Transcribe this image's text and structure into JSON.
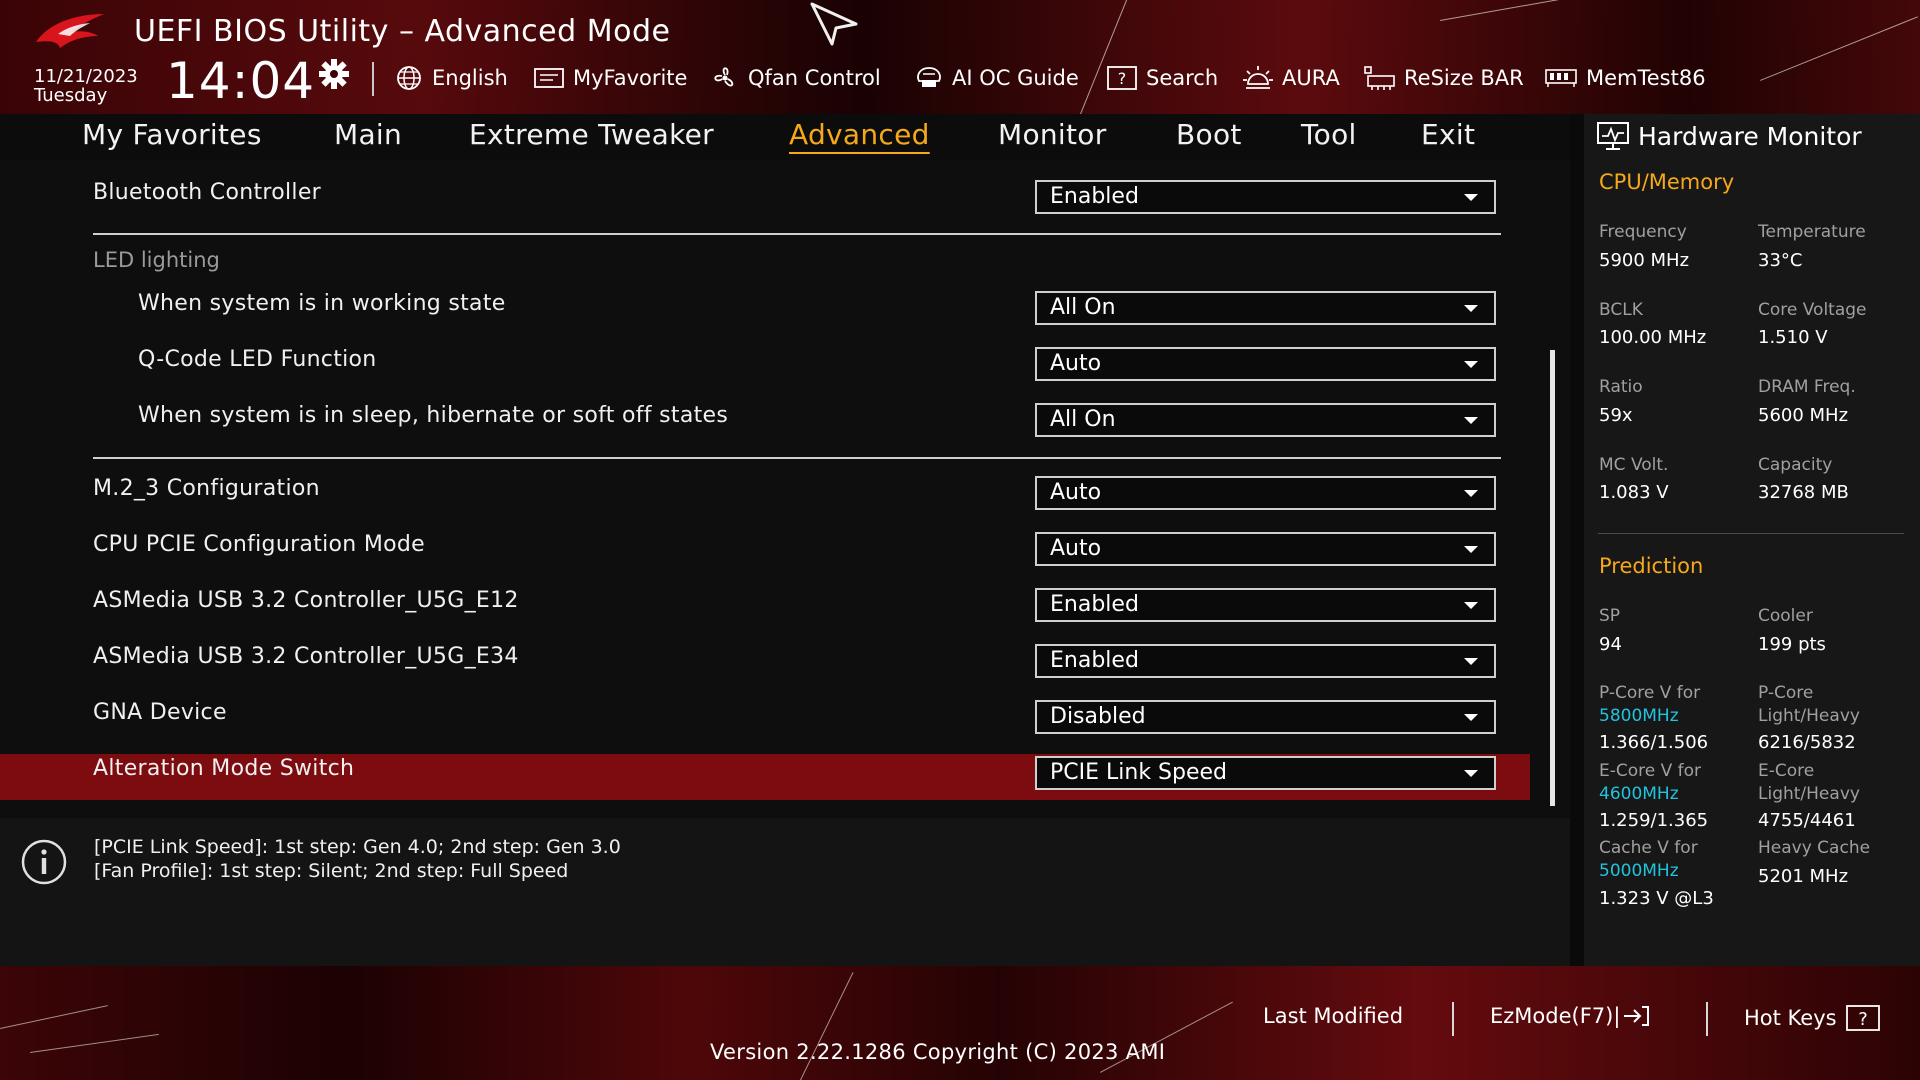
{
  "header": {
    "title": "UEFI BIOS Utility – Advanced Mode",
    "date": "11/21/2023",
    "weekday": "Tuesday",
    "time": "14:04",
    "logo_icon": "rog-eye-logo",
    "toolbar": [
      {
        "label": "English",
        "icon": "globe-icon"
      },
      {
        "label": "MyFavorite",
        "icon": "favorite-card-icon"
      },
      {
        "label": "Qfan Control",
        "icon": "fan-icon"
      },
      {
        "label": "AI OC Guide",
        "icon": "ai-chip-icon"
      },
      {
        "label": "Search",
        "icon": "question-box-icon"
      },
      {
        "label": "AURA",
        "icon": "aura-light-icon"
      },
      {
        "label": "ReSize BAR",
        "icon": "resize-bar-icon"
      },
      {
        "label": "MemTest86",
        "icon": "memory-icon"
      }
    ]
  },
  "tabs": [
    {
      "label": "My Favorites",
      "active": false
    },
    {
      "label": "Main",
      "active": false
    },
    {
      "label": "Extreme Tweaker",
      "active": false
    },
    {
      "label": "Advanced",
      "active": true
    },
    {
      "label": "Monitor",
      "active": false
    },
    {
      "label": "Boot",
      "active": false
    },
    {
      "label": "Tool",
      "active": false
    },
    {
      "label": "Exit",
      "active": false
    }
  ],
  "settings": {
    "bluetooth": {
      "label": "Bluetooth Controller",
      "value": "Enabled"
    },
    "led_group": "LED lighting",
    "led_working": {
      "label": "When system is in working state",
      "value": "All On"
    },
    "qcode": {
      "label": "Q-Code LED Function",
      "value": "Auto"
    },
    "led_sleep": {
      "label": "When system is in sleep, hibernate or soft off states",
      "value": "All On"
    },
    "m2_3": {
      "label": "M.2_3 Configuration",
      "value": "Auto"
    },
    "cpu_pcie": {
      "label": "CPU PCIE Configuration Mode",
      "value": "Auto"
    },
    "asmedia_e12": {
      "label": "ASMedia USB 3.2 Controller_U5G_E12",
      "value": "Enabled"
    },
    "asmedia_e34": {
      "label": "ASMedia USB 3.2 Controller_U5G_E34",
      "value": "Enabled"
    },
    "gna": {
      "label": "GNA Device",
      "value": "Disabled"
    },
    "alteration": {
      "label": "Alteration Mode Switch",
      "value": "PCIE Link Speed"
    }
  },
  "info": {
    "line1": "[PCIE Link Speed]: 1st step: Gen 4.0; 2nd step: Gen 3.0",
    "line2": "[Fan Profile]: 1st step: Silent; 2nd step: Full Speed"
  },
  "hardware_monitor": {
    "title": "Hardware Monitor",
    "cpu_memory": {
      "heading": "CPU/Memory",
      "frequency": {
        "label": "Frequency",
        "value": "5900 MHz"
      },
      "temperature": {
        "label": "Temperature",
        "value": "33°C"
      },
      "bclk": {
        "label": "BCLK",
        "value": "100.00 MHz"
      },
      "core_voltage": {
        "label": "Core Voltage",
        "value": "1.510 V"
      },
      "ratio": {
        "label": "Ratio",
        "value": "59x"
      },
      "dram_freq": {
        "label": "DRAM Freq.",
        "value": "5600 MHz"
      },
      "mc_volt": {
        "label": "MC Volt.",
        "value": "1.083 V"
      },
      "capacity": {
        "label": "Capacity",
        "value": "32768 MB"
      }
    },
    "prediction": {
      "heading": "Prediction",
      "sp": {
        "label": "SP",
        "value": "94"
      },
      "cooler": {
        "label": "Cooler",
        "value": "199 pts"
      },
      "pcore_v": {
        "label": "P-Core V for",
        "freq": "5800MHz",
        "value": "1.366/1.506"
      },
      "pcore_lh": {
        "label1": "P-Core",
        "label2": "Light/Heavy",
        "value": "6216/5832"
      },
      "ecore_v": {
        "label": "E-Core V for",
        "freq": "4600MHz",
        "value": "1.259/1.365"
      },
      "ecore_lh": {
        "label1": "E-Core",
        "label2": "Light/Heavy",
        "value": "4755/4461"
      },
      "cache_v": {
        "label": "Cache V for",
        "freq": "5000MHz",
        "value": "1.323 V @L3"
      },
      "heavy_cache": {
        "label": "Heavy Cache",
        "value": "5201 MHz"
      }
    }
  },
  "footer": {
    "last_modified": "Last Modified",
    "ezmode": "EzMode(F7)|",
    "hot_keys": "Hot Keys",
    "version": "Version 2.22.1286 Copyright (C) 2023 AMI"
  },
  "colors": {
    "accent": "#f5a81a",
    "selection": "#7c0c10",
    "cyan": "#21c3dd"
  }
}
